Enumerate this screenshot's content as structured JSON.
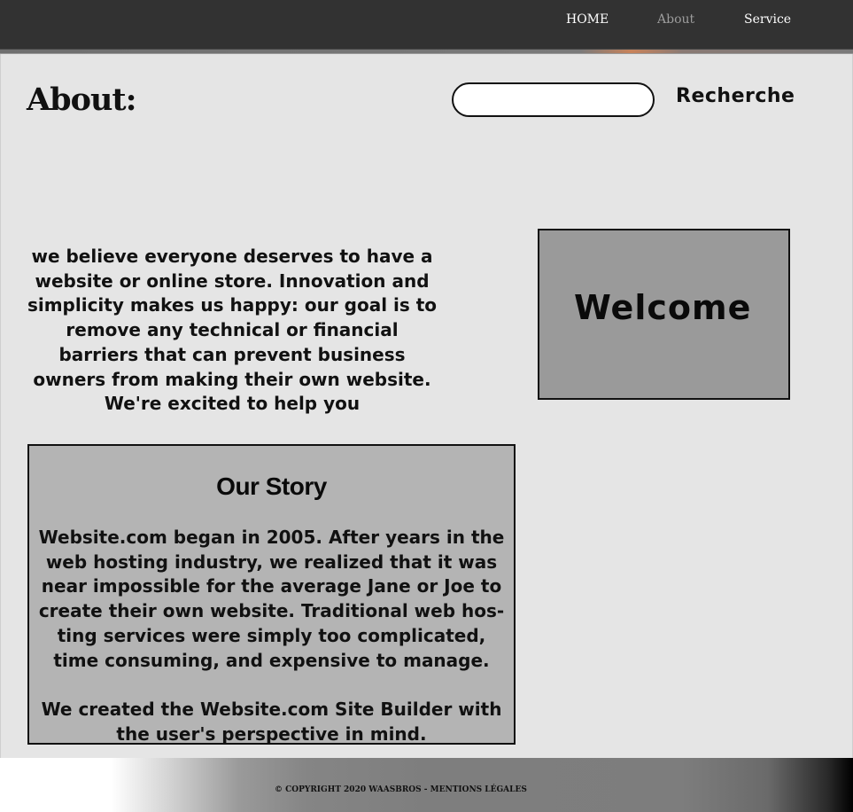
{
  "nav": {
    "items": [
      {
        "label": "HOME",
        "active": false
      },
      {
        "label": "About",
        "active": true
      },
      {
        "label": "Service",
        "active": false
      }
    ]
  },
  "page": {
    "title": "About:"
  },
  "search": {
    "value": "",
    "placeholder": "",
    "button_label": "Recherche"
  },
  "intro": {
    "text": "we believe everyone deserves to have a website or online store. Innovation and simplicity makes us happy: our goal is to remove any technical or financial barriers that can prevent business owners from making their own website. We're excited to help you"
  },
  "welcome": {
    "text": "Welcome"
  },
  "story": {
    "title": "Our Story",
    "paragraphs": [
      "Website.com began in 2005. After years in the web hosting industry, we realized that it was near impossible for the average Jane or Joe to create their own website. Traditional web hos-ting services were simply too complicated, time consuming, and expensive to manage.",
      "We created the Website.com Site Builder with the user's perspective in mind."
    ]
  },
  "footer": {
    "text": "© COPYRIGHT 2020 WAASBROS - MENTIONS LÉGALES"
  },
  "colors": {
    "header_bg": "#323232",
    "page_bg": "#e5e5e5",
    "welcome_bg": "#9a9a9a",
    "story_bg": "#b4b4b4",
    "nav_active": "#9c9c9c"
  }
}
